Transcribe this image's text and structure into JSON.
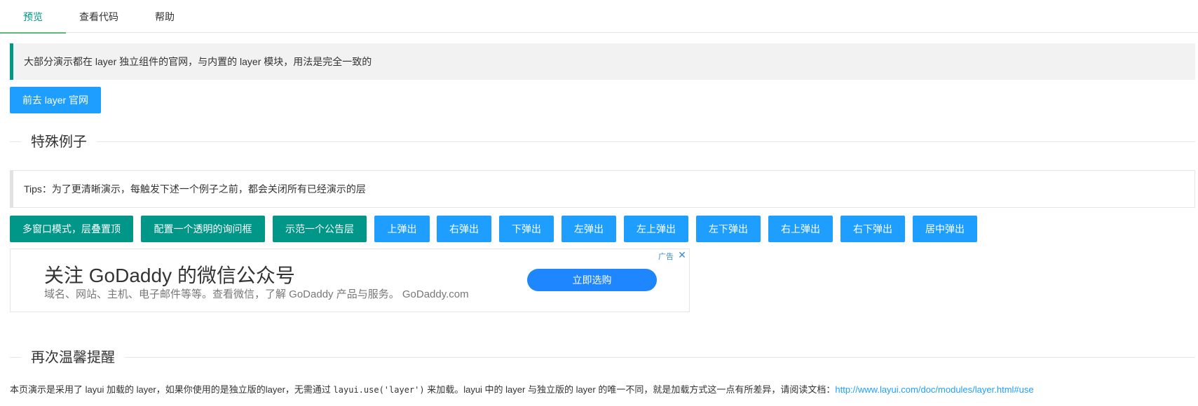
{
  "tabs": [
    {
      "label": "预览",
      "active": true
    },
    {
      "label": "查看代码",
      "active": false
    },
    {
      "label": "帮助",
      "active": false
    }
  ],
  "intro": {
    "text": "大部分演示都在 layer 独立组件的官网，与内置的 layer 模块，用法是完全一致的",
    "button_label": "前去 layer 官网"
  },
  "section_special": {
    "title": "特殊例子",
    "tips": "Tips：为了更清晰演示，每触发下述一个例子之前，都会关闭所有已经演示的层"
  },
  "demo_buttons": [
    {
      "label": "多窗口模式，层叠置顶",
      "color": "green"
    },
    {
      "label": "配置一个透明的询问框",
      "color": "green"
    },
    {
      "label": "示范一个公告层",
      "color": "green"
    },
    {
      "label": "上弹出",
      "color": "blue"
    },
    {
      "label": "右弹出",
      "color": "blue"
    },
    {
      "label": "下弹出",
      "color": "blue"
    },
    {
      "label": "左弹出",
      "color": "blue"
    },
    {
      "label": "左上弹出",
      "color": "blue"
    },
    {
      "label": "左下弹出",
      "color": "blue"
    },
    {
      "label": "右上弹出",
      "color": "blue"
    },
    {
      "label": "右下弹出",
      "color": "blue"
    },
    {
      "label": "居中弹出",
      "color": "blue"
    }
  ],
  "ad": {
    "title": "关注 GoDaddy 的微信公众号",
    "desc": "域名、网站、主机、电子邮件等等。查看微信，了解 GoDaddy 产品与服务。 GoDaddy.com",
    "cta": "立即选购",
    "tag": "广告",
    "close_icon": "close-icon"
  },
  "section_reminder": {
    "title": "再次温馨提醒",
    "note_pre": "本页演示是采用了 layui 加载的 layer，如果你使用的是独立版的layer，无需通过 ",
    "note_code": "layui.use('layer')",
    "note_mid": " 来加载。layui 中的 layer 与独立版的 layer 的唯一不同，就是加载方式这一点有所差异，请阅读文档：",
    "note_link": "http://www.layui.com/doc/modules/layer.html#use"
  },
  "colors": {
    "green": "#009688",
    "blue": "#1E9FFF",
    "tab_indicator": "#5FB878"
  }
}
